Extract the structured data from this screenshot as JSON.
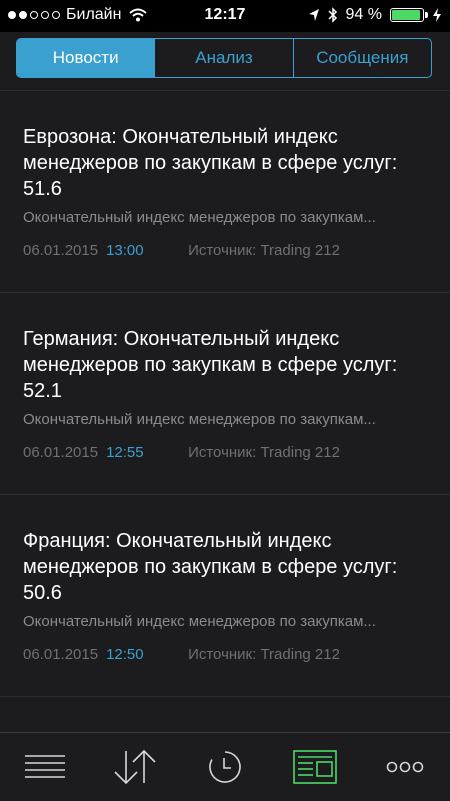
{
  "status_bar": {
    "carrier": "Билайн",
    "time": "12:17",
    "battery_text": "94 %",
    "battery_level": 0.94,
    "signal_bars_filled": 2,
    "signal_bars_total": 5
  },
  "tabs": [
    {
      "label": "Новости",
      "active": true
    },
    {
      "label": "Анализ",
      "active": false
    },
    {
      "label": "Сообщения",
      "active": false
    }
  ],
  "news": [
    {
      "title": "Еврозона: Окончательный индекс менеджеров по закупкам в сфере услуг: 51.6",
      "snippet": "Окончательный индекс менеджеров по закупкам...",
      "date": "06.01.2015",
      "time": "13:00",
      "source": "Источник: Trading 212"
    },
    {
      "title": "Германия: Окончательный индекс менеджеров по закупкам в сфере услуг: 52.1",
      "snippet": "Окончательный индекс менеджеров по закупкам...",
      "date": "06.01.2015",
      "time": "12:55",
      "source": "Источник: Trading 212"
    },
    {
      "title": "Франция: Окончательный индекс менеджеров по закупкам в сфере услуг: 50.6",
      "snippet": "Окончательный индекс менеджеров по закупкам...",
      "date": "06.01.2015",
      "time": "12:50",
      "source": "Источник: Trading 212"
    }
  ],
  "bottom_tabs": [
    {
      "icon": "menu-icon",
      "active": false
    },
    {
      "icon": "transfer-arrows-icon",
      "active": false
    },
    {
      "icon": "history-clock-icon",
      "active": false
    },
    {
      "icon": "news-icon",
      "active": true
    },
    {
      "icon": "more-dots-icon",
      "active": false
    }
  ],
  "colors": {
    "background": "#1c1c1f",
    "accent": "#3aa0d0",
    "active_tab": "#4cd964",
    "muted_text": "#8a8a8f"
  }
}
